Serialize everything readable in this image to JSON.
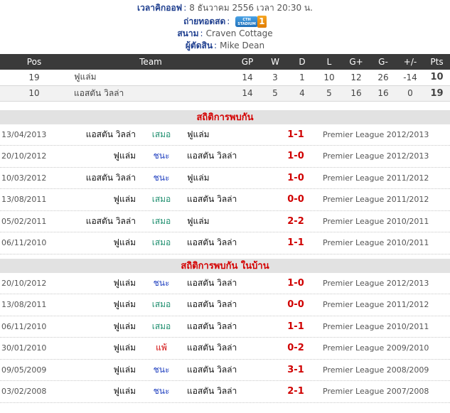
{
  "info": {
    "kickoff_label": "เวลาคิกออฟ",
    "kickoff_value": "8 ธันวาคม 2556 เวลา 20:30 น.",
    "broadcast_label": "ถ่ายทอดสด",
    "broadcast_channel_top": "CTH",
    "broadcast_channel_bottom": "STADIUM",
    "broadcast_channel_number": "1",
    "venue_label": "สนาม",
    "venue_value": "Craven Cottage",
    "referee_label": "ผู้ตัดสิน",
    "referee_value": "Mike Dean"
  },
  "standings": {
    "headers": [
      "Pos",
      "Team",
      "GP",
      "W",
      "D",
      "L",
      "G+",
      "G-",
      "+/-",
      "Pts"
    ],
    "rows": [
      {
        "pos": "19",
        "team": "ฟูแล่ม",
        "gp": "14",
        "w": "3",
        "d": "1",
        "l": "10",
        "gf": "12",
        "ga": "26",
        "diff": "-14",
        "pts": "10"
      },
      {
        "pos": "10",
        "team": "แอสตัน วิลล่า",
        "gp": "14",
        "w": "5",
        "d": "4",
        "l": "5",
        "gf": "16",
        "ga": "16",
        "diff": "0",
        "pts": "19"
      }
    ]
  },
  "h2h": {
    "title": "สถิติการพบกัน",
    "matches": [
      {
        "date": "13/04/2013",
        "home": "แอสตัน วิลล่า",
        "result": "เสมอ",
        "away": "ฟูแล่ม",
        "score": "1-1",
        "competition": "Premier League 2012/2013"
      },
      {
        "date": "20/10/2012",
        "home": "ฟูแล่ม",
        "result": "ชนะ",
        "away": "แอสตัน วิลล่า",
        "score": "1-0",
        "competition": "Premier League 2012/2013"
      },
      {
        "date": "10/03/2012",
        "home": "แอสตัน วิลล่า",
        "result": "ชนะ",
        "away": "ฟูแล่ม",
        "score": "1-0",
        "competition": "Premier League 2011/2012"
      },
      {
        "date": "13/08/2011",
        "home": "ฟูแล่ม",
        "result": "เสมอ",
        "away": "แอสตัน วิลล่า",
        "score": "0-0",
        "competition": "Premier League 2011/2012"
      },
      {
        "date": "05/02/2011",
        "home": "แอสตัน วิลล่า",
        "result": "เสมอ",
        "away": "ฟูแล่ม",
        "score": "2-2",
        "competition": "Premier League 2010/2011"
      },
      {
        "date": "06/11/2010",
        "home": "ฟูแล่ม",
        "result": "เสมอ",
        "away": "แอสตัน วิลล่า",
        "score": "1-1",
        "competition": "Premier League 2010/2011"
      }
    ]
  },
  "home_h2h": {
    "title": "สถิติการพบกัน ในบ้าน",
    "matches": [
      {
        "date": "20/10/2012",
        "home": "ฟูแล่ม",
        "result": "ชนะ",
        "away": "แอสตัน วิลล่า",
        "score": "1-0",
        "competition": "Premier League 2012/2013"
      },
      {
        "date": "13/08/2011",
        "home": "ฟูแล่ม",
        "result": "เสมอ",
        "away": "แอสตัน วิลล่า",
        "score": "0-0",
        "competition": "Premier League 2011/2012"
      },
      {
        "date": "06/11/2010",
        "home": "ฟูแล่ม",
        "result": "เสมอ",
        "away": "แอสตัน วิลล่า",
        "score": "1-1",
        "competition": "Premier League 2010/2011"
      },
      {
        "date": "30/01/2010",
        "home": "ฟูแล่ม",
        "result": "แพ้",
        "away": "แอสตัน วิลล่า",
        "score": "0-2",
        "competition": "Premier League 2009/2010"
      },
      {
        "date": "09/05/2009",
        "home": "ฟูแล่ม",
        "result": "ชนะ",
        "away": "แอสตัน วิลล่า",
        "score": "3-1",
        "competition": "Premier League 2008/2009"
      },
      {
        "date": "03/02/2008",
        "home": "ฟูแล่ม",
        "result": "ชนะ",
        "away": "แอสตัน วิลล่า",
        "score": "2-1",
        "competition": "Premier League 2007/2008"
      }
    ]
  },
  "colors": {
    "win": "#1f3fbf",
    "draw": "#1f8f6f",
    "loss": "#d00000"
  }
}
